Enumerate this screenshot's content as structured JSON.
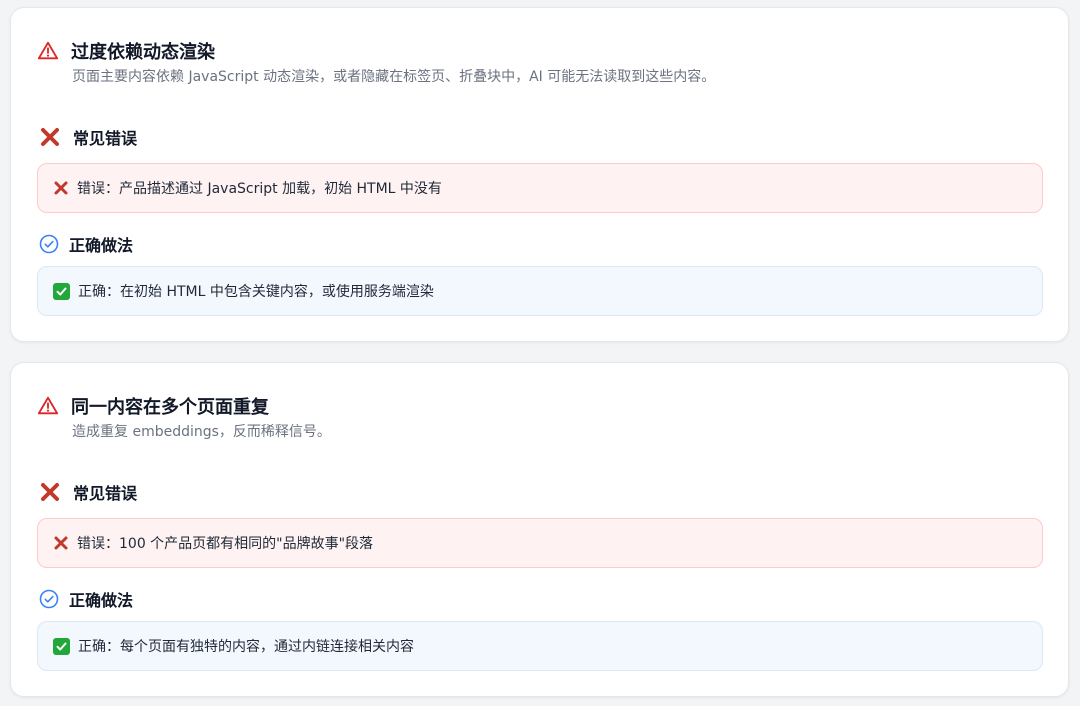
{
  "cards": [
    {
      "title": "过度依赖动态渲染",
      "subtitle": "页面主要内容依赖 JavaScript 动态渲染，或者隐藏在标签页、折叠块中，AI 可能无法读取到这些内容。",
      "wrong_heading": "常见错误",
      "wrong_text": "错误：产品描述通过 JavaScript 加载，初始 HTML 中没有",
      "right_heading": "正确做法",
      "right_text": "正确：在初始 HTML 中包含关键内容，或使用服务端渲染"
    },
    {
      "title": "同一内容在多个页面重复",
      "subtitle": "造成重复 embeddings，反而稀释信号。",
      "wrong_heading": "常见错误",
      "wrong_text": "错误：100 个产品页都有相同的\"品牌故事\"段落",
      "right_heading": "正确做法",
      "right_text": "正确：每个页面有独特的内容，通过内链连接相关内容"
    }
  ],
  "icons": {
    "warning": "warning-triangle-icon",
    "wrong": "cross-mark-icon",
    "right": "check-circle-icon",
    "check": "check-box-icon"
  },
  "colors": {
    "warning": "#dc2626",
    "cross": "#c0392b",
    "check_circle": "#3b82f6",
    "check_box": "#22a83a",
    "wrong_bg": "#fef2f2",
    "right_bg": "#f3f8fe"
  }
}
